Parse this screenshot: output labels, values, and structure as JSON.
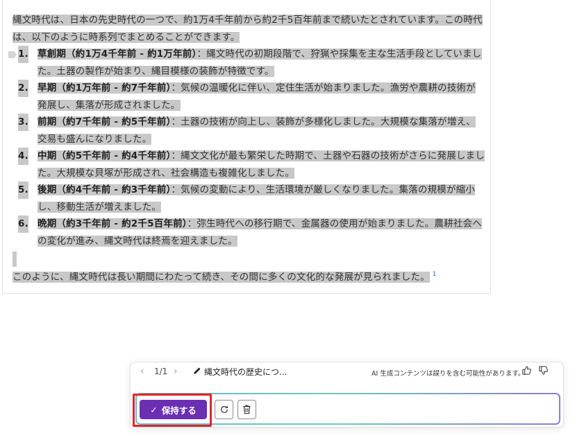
{
  "document": {
    "intro": "縄文時代は、日本の先史時代の一つで、約1万4千年前から約2千5百年前まで続いたとされています。この時代は、以下のように時系列でまとめることができます。",
    "periods": [
      {
        "num": "1.",
        "term": "草創期（約1万4千年前 - 約1万年前）",
        "desc": "：縄文時代の初期段階で、狩猟や採集を主な生活手段としていました。土器の製作が始まり、縄目模様の装飾が特徴です。"
      },
      {
        "num": "2.",
        "term": "早期（約1万年前 - 約7千年前）",
        "desc": "：気候の温暖化に伴い、定住生活が始まりました。漁労や農耕の技術が発展し、集落が形成されました。"
      },
      {
        "num": "3.",
        "term": "前期（約7千年前 - 約5千年前）",
        "desc": "：土器の技術が向上し、装飾が多様化しました。大規模な集落が増え、交易も盛んになりました。"
      },
      {
        "num": "4.",
        "term": "中期（約5千年前 - 約4千年前）",
        "desc": "：縄文文化が最も繁栄した時期で、土器や石器の技術がさらに発展しました。大規模な貝塚が形成され、社会構造も複雑化しました。"
      },
      {
        "num": "5.",
        "term": "後期（約4千年前 - 約3千年前）",
        "desc": "：気候の変動により、生活環境が厳しくなりました。集落の規模が縮小し、移動生活が増えました。"
      },
      {
        "num": "6.",
        "term": "晩期（約3千年前 - 約2千5百年前）",
        "desc": "：弥生時代への移行期で、金属器の使用が始まりました。農耕社会への変化が進み、縄文時代は終焉を迎えました。"
      }
    ],
    "outro": "このように、縄文時代は長い期間にわたって続き、その間に多くの文化的な発展が見られました。",
    "citation": "1"
  },
  "ai_bar": {
    "prev_icon": "chevron-left",
    "next_icon": "chevron-right",
    "page_count": "1/1",
    "draft_title": "縄文時代の歴史につ...",
    "disclaimer": "AI 生成コンテンツは誤りを含む可能性があります。",
    "keep_label": "保持する",
    "colors": {
      "accent": "#6b2fb3",
      "highlight": "#e3242b"
    }
  }
}
